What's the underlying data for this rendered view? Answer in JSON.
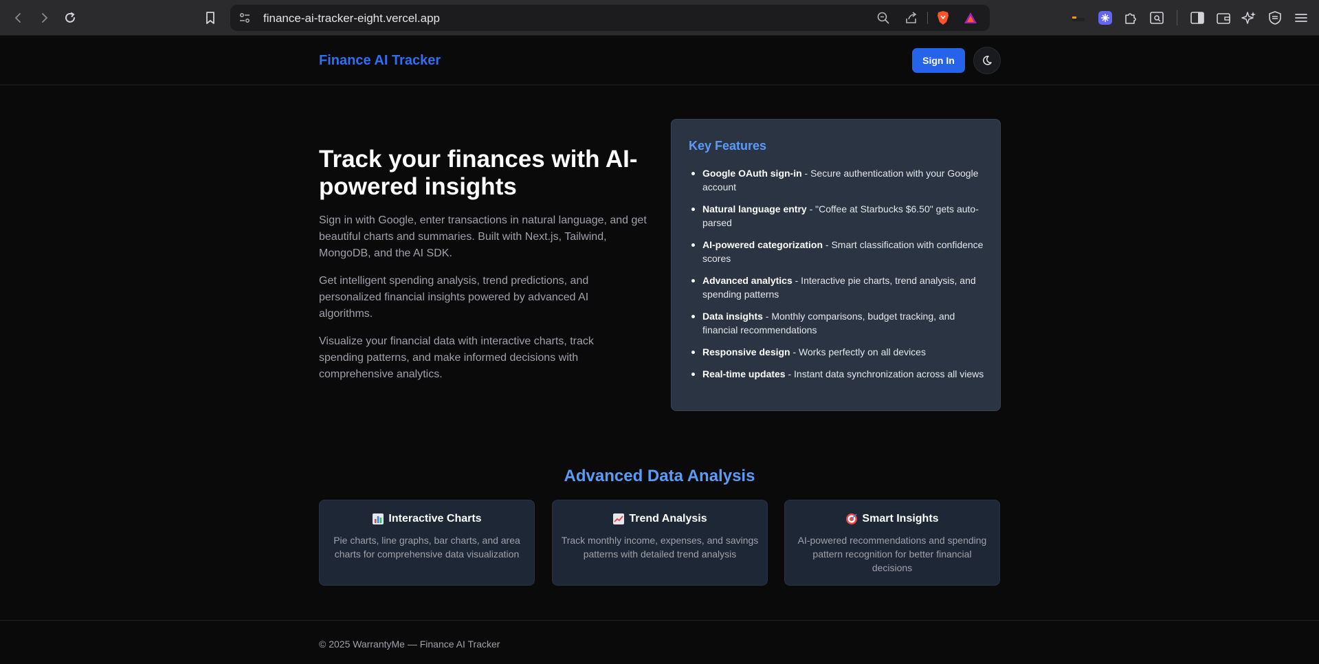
{
  "browser": {
    "url": "finance-ai-tracker-eight.vercel.app"
  },
  "header": {
    "brand": "Finance AI Tracker",
    "signin_label": "Sign In"
  },
  "hero": {
    "title": "Track your finances with AI-powered insights",
    "paragraphs": [
      "Sign in with Google, enter transactions in natural language, and get beautiful charts and summaries. Built with Next.js, Tailwind, MongoDB, and the AI SDK.",
      "Get intelligent spending analysis, trend predictions, and personalized financial insights powered by advanced AI algorithms.",
      "Visualize your financial data with interactive charts, track spending patterns, and make informed decisions with comprehensive analytics."
    ]
  },
  "features": {
    "title": "Key Features",
    "items": [
      {
        "name": "Google OAuth sign-in",
        "desc": " - Secure authentication with your Google account"
      },
      {
        "name": "Natural language entry",
        "desc": " - \"Coffee at Starbucks $6.50\" gets auto-parsed"
      },
      {
        "name": "AI-powered categorization",
        "desc": " - Smart classification with confidence scores"
      },
      {
        "name": "Advanced analytics",
        "desc": " - Interactive pie charts, trend analysis, and spending patterns"
      },
      {
        "name": "Data insights",
        "desc": " - Monthly comparisons, budget tracking, and financial recommendations"
      },
      {
        "name": "Responsive design",
        "desc": " - Works perfectly on all devices"
      },
      {
        "name": "Real-time updates",
        "desc": " - Instant data synchronization across all views"
      }
    ]
  },
  "advanced": {
    "title": "Advanced Data Analysis",
    "cards": [
      {
        "title": "Interactive Charts",
        "icon": "bar-chart-emoji",
        "body": "Pie charts, line graphs, bar charts, and area charts for comprehensive data visualization"
      },
      {
        "title": "Trend Analysis",
        "icon": "trending-up-emoji",
        "body": "Track monthly income, expenses, and savings patterns with detailed trend analysis"
      },
      {
        "title": "Smart Insights",
        "icon": "target-emoji",
        "body": "AI-powered recommendations and spending pattern recognition for better financial decisions"
      }
    ]
  },
  "footer": {
    "text": "© 2025 WarrantyMe — Finance AI Tracker"
  },
  "colors": {
    "brand": "#2f6ef5",
    "accent": "#5b9bf8",
    "button": "#2563eb",
    "background": "#0a0a0a",
    "card": "#2a3443"
  }
}
